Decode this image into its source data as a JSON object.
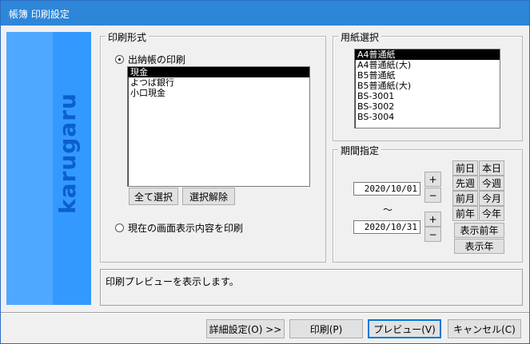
{
  "window": {
    "title": "帳簿 印刷設定"
  },
  "sidebar": {
    "brand": "karugaru"
  },
  "print_format": {
    "legend": "印刷形式",
    "radio_ledger": "出納帳の印刷",
    "radio_screen": "現在の画面表示内容を印刷",
    "ledger_items": [
      {
        "label": "現金",
        "selected": true
      },
      {
        "label": "よつば銀行",
        "selected": false
      },
      {
        "label": "小口現金",
        "selected": false
      }
    ],
    "select_all_label": "全て選択",
    "deselect_label": "選択解除"
  },
  "paper": {
    "legend": "用紙選択",
    "items": [
      {
        "label": "A4普通紙",
        "selected": true
      },
      {
        "label": "A4普通紙(大)",
        "selected": false
      },
      {
        "label": "B5普通紙",
        "selected": false
      },
      {
        "label": "B5普通紙(大)",
        "selected": false
      },
      {
        "label": "BS-3001",
        "selected": false
      },
      {
        "label": "BS-3002",
        "selected": false
      },
      {
        "label": "BS-3004",
        "selected": false
      }
    ]
  },
  "period": {
    "legend": "期間指定",
    "start_date": "2020/10/01",
    "end_date": "2020/10/31",
    "tilde": "〜",
    "plus": "+",
    "minus": "−",
    "quick": {
      "prev_day": "前日",
      "today": "本日",
      "prev_week": "先週",
      "this_week": "今週",
      "prev_month": "前月",
      "this_month": "今月",
      "prev_year": "前年",
      "this_year": "今年",
      "display_prev_year": "表示前年",
      "display_year": "表示年"
    }
  },
  "status_text": "印刷プレビューを表示します。",
  "footer": {
    "details_label": "詳細設定(O) >>",
    "print_label": "印刷(P)",
    "preview_label": "プレビュー(V)",
    "cancel_label": "キャンセル(C)"
  }
}
